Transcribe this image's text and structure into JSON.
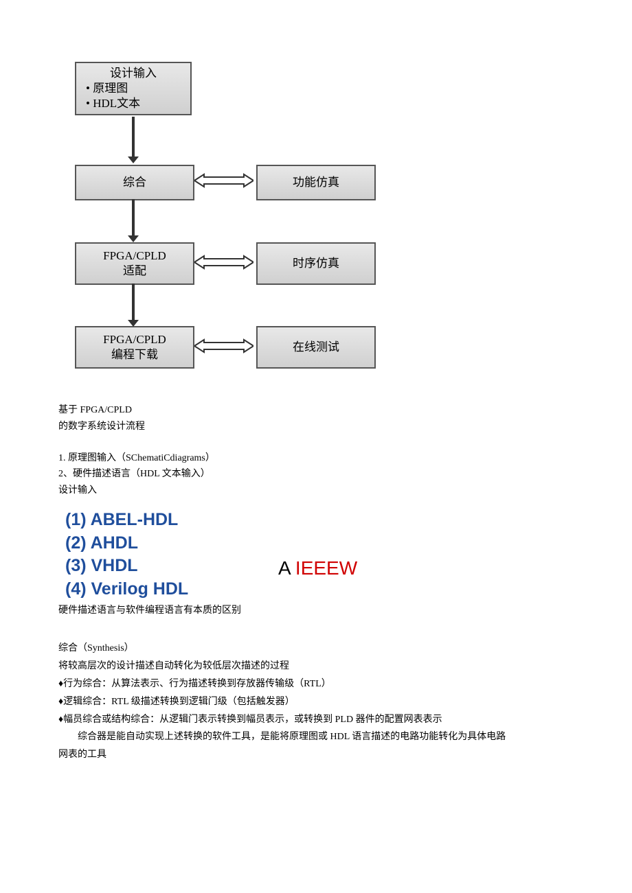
{
  "diagram": {
    "input": {
      "title": "设计输入",
      "b1": "• 原理图",
      "b2": "• HDL文本"
    },
    "synth": "综合",
    "fit": {
      "l1": "FPGA/CPLD",
      "l2": "适配"
    },
    "prog": {
      "l1": "FPGA/CPLD",
      "l2": "编程下载"
    },
    "func": "功能仿真",
    "time": "时序仿真",
    "test": "在线测试"
  },
  "caption": {
    "l1": "基于 FPGA/CPLD",
    "l2": "的数字系统设计流程"
  },
  "list1": {
    "i1": "1. 原理图输入（SChematiCdiagrams）",
    "i2": "2、硬件描述语言（HDL 文本输入）",
    "i3": "设计输入"
  },
  "hdl": {
    "i1": "(1)  ABEL-HDL",
    "i2": "(2)  AHDL",
    "i3": "(3)  VHDL",
    "i4": "(4)  Verilog HDL",
    "ieee_a": "A ",
    "ieee_r": "IEEEW"
  },
  "note": "硬件描述语言与软件编程语言有本质的区别",
  "sect": {
    "t": "综合（Synthesis）",
    "l1": "将较高层次的设计描述自动转化为较低层次描述的过程",
    "l2": "♦行为综合：从算法表示、行为描述转换到存放器传输级（RTL）",
    "l3": "♦逻辑综合：RTL 级描述转换到逻辑门级（包括触发器）",
    "l4": "♦幅员综合或结构综合：从逻辑门表示转换到幅员表示，或转换到 PLD 器件的配置网表表示",
    "l5": "综合器是能自动实现上述转换的软件工具，是能将原理图或 HDL 语言描述的电路功能转化为具体电路",
    "l6": "网表的工具"
  }
}
